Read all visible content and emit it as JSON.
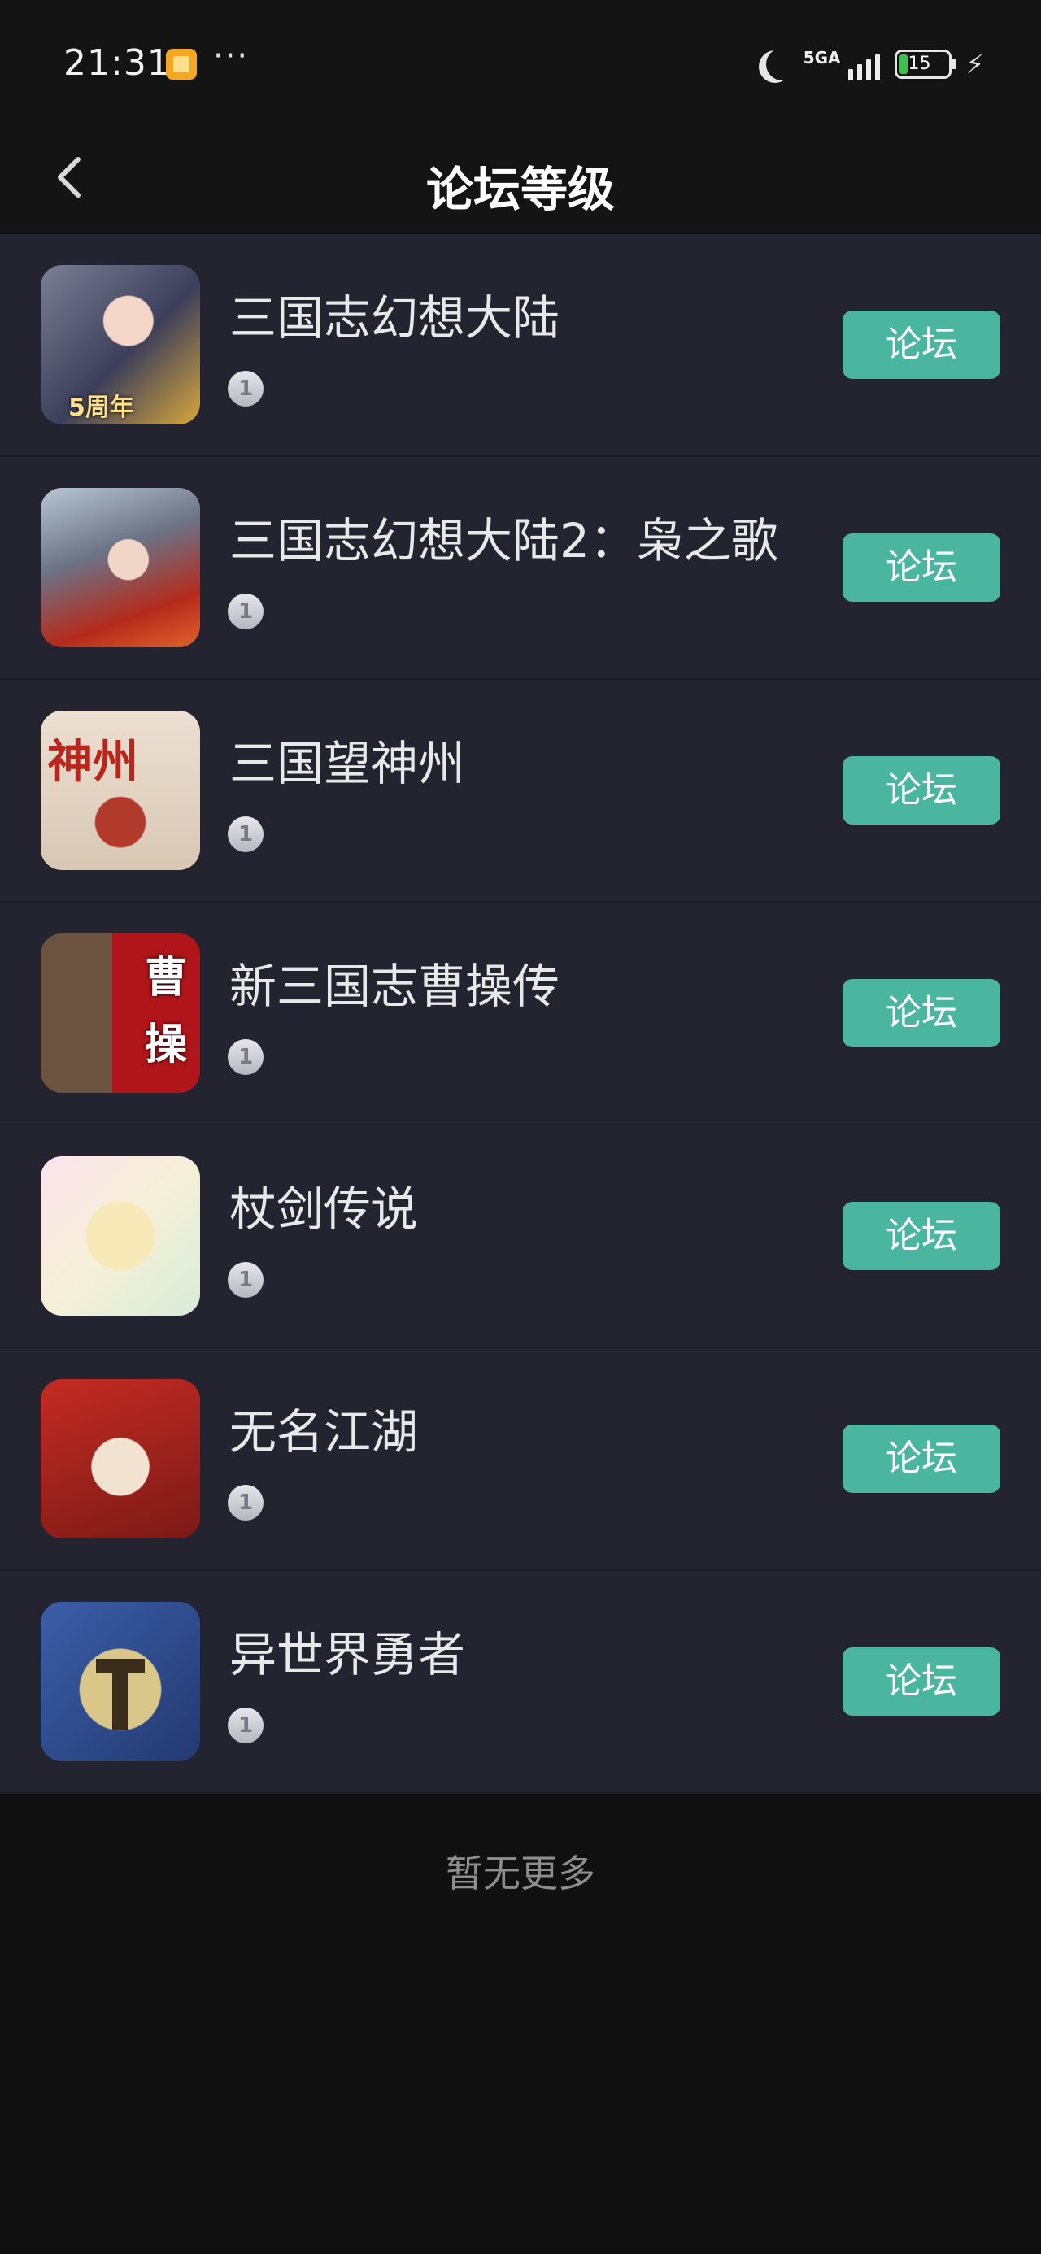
{
  "status_bar": {
    "time": "21:31",
    "more": "···",
    "network": "5GA",
    "battery_level": "15",
    "icons": [
      "app-notification-icon",
      "moon-icon",
      "signal-icon",
      "battery-icon",
      "charging-icon"
    ]
  },
  "header": {
    "title": "论坛等级",
    "back_icon": "chevron-left-icon"
  },
  "games": [
    {
      "name": "三国志幻想大陆",
      "level": "1",
      "button": "论坛",
      "icon_text": "5周年"
    },
    {
      "name": "三国志幻想大陆2：枭之歌",
      "level": "1",
      "button": "论坛",
      "icon_text": ""
    },
    {
      "name": "三国望神州",
      "level": "1",
      "button": "论坛",
      "icon_text": "神州"
    },
    {
      "name": "新三国志曹操传",
      "level": "1",
      "button": "论坛",
      "icon_text": "曹操"
    },
    {
      "name": "杖剑传说",
      "level": "1",
      "button": "论坛",
      "icon_text": ""
    },
    {
      "name": "无名江湖",
      "level": "1",
      "button": "论坛",
      "icon_text": ""
    },
    {
      "name": "异世界勇者",
      "level": "1",
      "button": "论坛",
      "icon_text": ""
    }
  ],
  "footer": {
    "text": "暂无更多"
  },
  "colors": {
    "accent": "#4ab6a0",
    "row_bg": "#23242f",
    "page_bg": "#101010"
  }
}
